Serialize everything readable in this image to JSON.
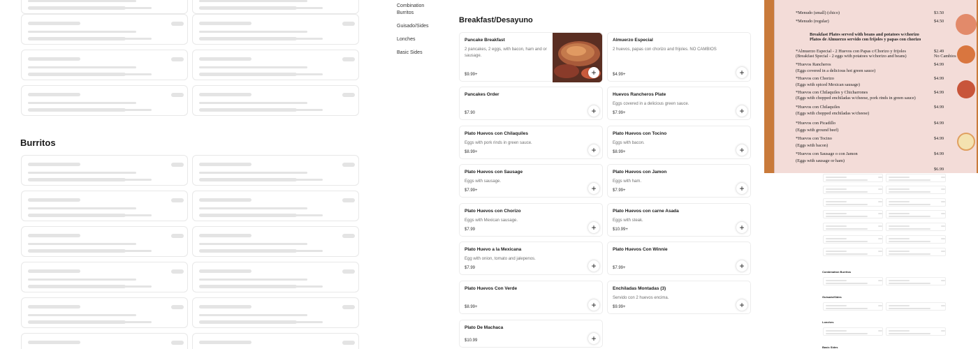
{
  "left_section": {
    "heading": "Burritos"
  },
  "categories": [
    "Combination Burritos",
    "Guisado/Sides",
    "Lonches",
    "Basic Sides"
  ],
  "menu": {
    "title": "Breakfast/Desayuno",
    "items": [
      {
        "name": "Pancake Breakfast",
        "desc": "2 pancakes, 2 eggs, with bacon, ham and or sausage.",
        "price": "$9.99+",
        "has_photo": true
      },
      {
        "name": "Almuerzo Especial",
        "desc": "2 huevos, papas con chorizo and frijoles. NO CAMBIOS",
        "price": "$4.99+"
      },
      {
        "name": "Pancakes Order",
        "desc": "",
        "price": "$7.90"
      },
      {
        "name": "Huevos Rancheros Plate",
        "desc": "Eggs covered in a delicious green sauce.",
        "price": "$7.99+"
      },
      {
        "name": "Plato Huevos con Chilaquiles",
        "desc": "Eggs with pork rinds in green sauce.",
        "price": "$8.99+"
      },
      {
        "name": "Plato Huevos con Tocino",
        "desc": "Eggs with bacon.",
        "price": "$8.99+"
      },
      {
        "name": "Plato Huevos con Sausage",
        "desc": "Eggs with sausage.",
        "price": "$7.99+"
      },
      {
        "name": "Plato Huevos con Jamon",
        "desc": "Eggs with ham.",
        "price": "$7.99+"
      },
      {
        "name": "Plato Huevos con Chorizo",
        "desc": "Eggs with Mexican sausage.",
        "price": "$7.99"
      },
      {
        "name": "Plato Huevos con carne Asada",
        "desc": "Eggs with steak.",
        "price": "$10.99+"
      },
      {
        "name": "Plato Huevo a la Mexicana",
        "desc": "Egg with onion, tomato and jalepenos.",
        "price": "$7.99"
      },
      {
        "name": "Plato Huevos Con Winnie",
        "desc": "",
        "price": "$7.99+"
      },
      {
        "name": "Plato Huevos Con Verde",
        "desc": "",
        "price": "$8.99+"
      },
      {
        "name": "Enchiladas Montadas (3)",
        "desc": "Servido con 2 huevos encima.",
        "price": "$9.99+"
      },
      {
        "name": "Plato De Machaca",
        "desc": "",
        "price": "$10.99"
      }
    ]
  },
  "menu_sheet": {
    "lines": [
      {
        "text": "*Menudo (small) (chico)",
        "price": "$3.50"
      },
      {
        "text": "*Menudo (regular)",
        "price": "$4.50"
      },
      {
        "text": "Breakfast Plates served with beans and potatoes w/chorizo",
        "price": "",
        "bold": true
      },
      {
        "text": "Platos de Almuerzo servido con frijoles y papas con chorizo",
        "price": "",
        "bold": true
      },
      {
        "text": "*Almuerzo Especial - 2 Huevos con Papas c/Chorizo y frijoles",
        "price": "$2.49"
      },
      {
        "text": "(Breakfast Special - 2 eggs with potatoes w/chorizo and beans)",
        "price": "No Cambios"
      },
      {
        "text": "*Huevos Rancheros",
        "price": "$4.99"
      },
      {
        "text": "(Eggs covered in a delicious hot green sauce)",
        "price": ""
      },
      {
        "text": "*Huevos con Chorizo",
        "price": "$4.99"
      },
      {
        "text": "(Eggs with spiced Mexican sausage)",
        "price": ""
      },
      {
        "text": "*Huevos con Chilaquiles y Chicharrones",
        "price": "$4.99"
      },
      {
        "text": "(Eggs with chopped enchiladas w/cheese, pork rinds in green sauce)",
        "price": ""
      },
      {
        "text": "*Huevos con Chilaquiles",
        "price": "$4.99"
      },
      {
        "text": "(Eggs with chopped enchiladas w/cheese)",
        "price": ""
      },
      {
        "text": "*Huevos con Picadillo",
        "price": "$4.99"
      },
      {
        "text": "(Eggs with ground beef)",
        "price": ""
      },
      {
        "text": "*Huevos con Tocino",
        "price": "$4.99"
      },
      {
        "text": "(Eggs with bacon)",
        "price": ""
      },
      {
        "text": "*Huevos con Sausage o con Jamon",
        "price": "$4.99"
      },
      {
        "text": "(Eggs with sausage or ham)",
        "price": ""
      },
      {
        "text": "",
        "price": "$6.99"
      }
    ]
  },
  "minimap": {
    "labels": [
      "Combination Burritos",
      "Guisado/Sides",
      "Lonches",
      "Basic Sides"
    ]
  },
  "colors": {
    "skeleton": "#e4e4e4",
    "border": "#ececec",
    "text": "#191919",
    "muted": "#707070"
  }
}
